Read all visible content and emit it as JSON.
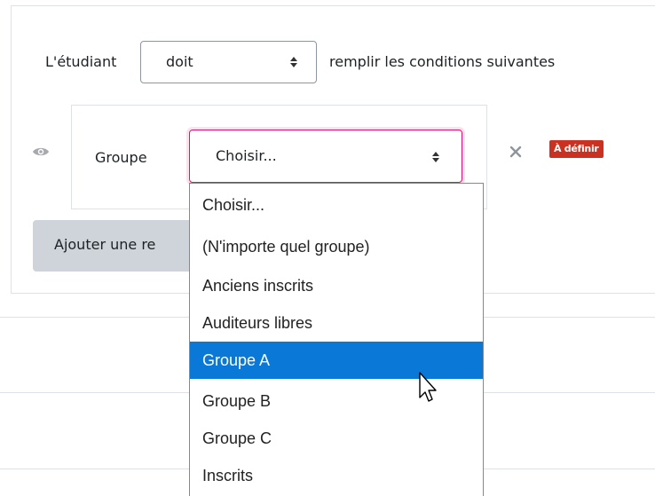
{
  "restriction": {
    "student_label": "L'étudiant",
    "must_select": {
      "value": "doit"
    },
    "conditions_text": "remplir les conditions suivantes"
  },
  "condition": {
    "type_label": "Groupe",
    "group_select": {
      "value": "Choisir..."
    },
    "badge": "À définir"
  },
  "add_button_label": "Ajouter une re",
  "dropdown": {
    "options": [
      "Choisir...",
      "(N'importe quel groupe)",
      "Anciens inscrits",
      "Auditeurs libres",
      "Groupe A",
      "Groupe B",
      "Groupe C",
      "Inscrits"
    ],
    "highlighted_index": 4
  },
  "colors": {
    "accent_focus": "#e8106a",
    "badge_bg": "#ca3120",
    "option_highlight": "#0a78d7",
    "button_bg": "#ced4da"
  },
  "icons": {
    "eye": "eye-icon",
    "close": "close-icon",
    "select_arrows": "sort-updown-icon",
    "cursor": "mouse-pointer-icon"
  }
}
